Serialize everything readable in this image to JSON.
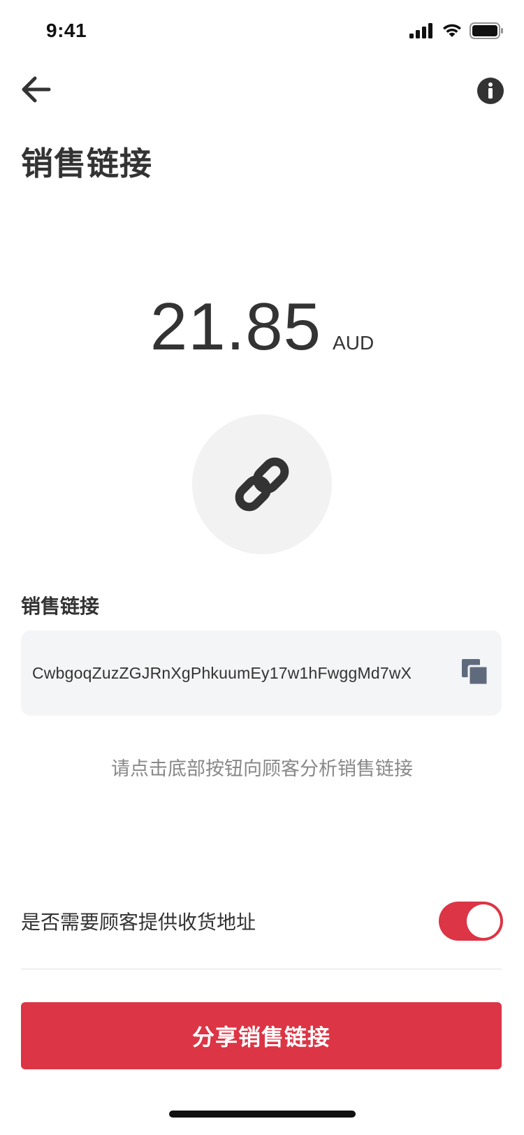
{
  "status_bar": {
    "time": "9:41"
  },
  "header": {
    "title": "销售链接"
  },
  "amount": {
    "value": "21.85",
    "currency": "AUD"
  },
  "link_section": {
    "label": "销售链接",
    "url": "CwbgoqZuzZGJRnXgPhkuumEy17w1hFwggMd7wX",
    "hint": "请点击底部按钮向顾客分析销售链接"
  },
  "address_toggle": {
    "label": "是否需要顾客提供收货地址",
    "enabled": true
  },
  "share_button": {
    "label": "分享销售链接"
  },
  "colors": {
    "accent": "#dc3545",
    "icon_dark": "#333333",
    "copy_icon": "#5f6b7d"
  },
  "icons": [
    "signal-icon",
    "wifi-icon",
    "battery-icon",
    "back-arrow-icon",
    "info-icon",
    "link-icon",
    "copy-icon"
  ]
}
